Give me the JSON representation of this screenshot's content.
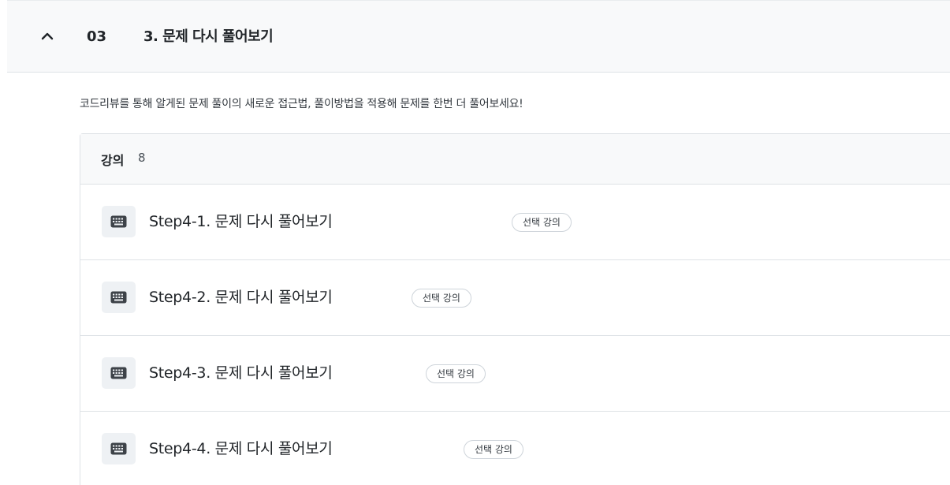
{
  "section": {
    "number": "03",
    "title": "3. 문제 다시 풀어보기",
    "toggle_icon": "chevron-up-icon",
    "description": "코드리뷰를 통해 알게된 문제 풀이의 새로운 접근법, 풀이방법을 적용해 문제를 한번 더 풀어보세요!"
  },
  "lectures": {
    "label": "강의",
    "count": "8",
    "items": [
      {
        "title": "Step4-1. 문제 다시 풀어보기",
        "badge": "선택 강의",
        "icon": "keyboard-icon"
      },
      {
        "title": "Step4-2. 문제 다시 풀어보기",
        "badge": "선택 강의",
        "icon": "keyboard-icon"
      },
      {
        "title": "Step4-3. 문제 다시 풀어보기",
        "badge": "선택 강의",
        "icon": "keyboard-icon"
      },
      {
        "title": "Step4-4. 문제 다시 풀어보기",
        "badge": "선택 강의",
        "icon": "keyboard-icon"
      }
    ]
  },
  "colors": {
    "header_bg": "#f8f9fa",
    "icon_bg": "#eef1f4",
    "border": "#dee2e6",
    "text": "#212529"
  }
}
